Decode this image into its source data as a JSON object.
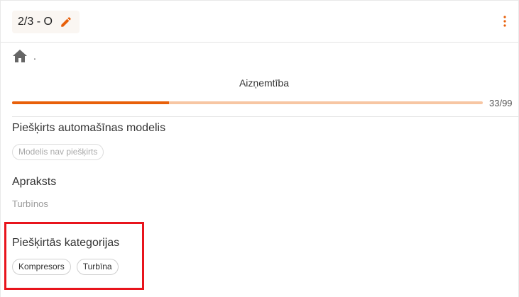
{
  "header": {
    "title": "2/3 - O",
    "edit_icon": "edit-pencil-icon",
    "menu_icon": "more-vertical-icon",
    "accent": "#e8600a"
  },
  "breadcrumb": {
    "home_icon": "home-icon",
    "current": "."
  },
  "occupancy": {
    "label": "Aizņemtība",
    "value_text": "33/99",
    "current": 33,
    "max": 99,
    "fill_color": "#e8600a",
    "track_color": "#f7c6a3"
  },
  "sections": {
    "car_model": {
      "title": "Piešķirts automašīnas modelis",
      "chip": "Modelis nav piešķirts"
    },
    "description": {
      "title": "Apraksts",
      "value": "Turbīnos"
    },
    "categories": {
      "title": "Piešķirtās kategorijas",
      "chips": [
        "Kompresors",
        "Turbīna"
      ],
      "highlight_color": "#e8141c"
    }
  }
}
